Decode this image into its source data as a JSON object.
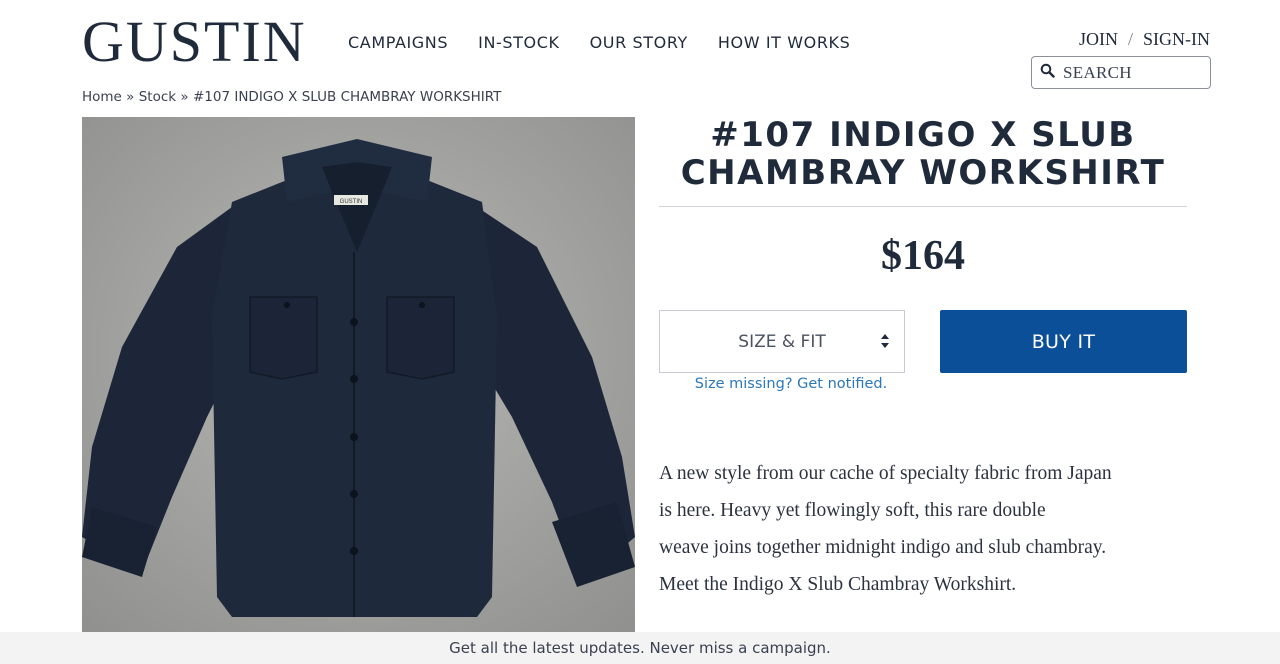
{
  "header": {
    "logo": "GUSTIN",
    "nav": [
      {
        "label": "CAMPAIGNS"
      },
      {
        "label": "IN-STOCK"
      },
      {
        "label": "OUR STORY"
      },
      {
        "label": "HOW IT WORKS"
      }
    ],
    "account": {
      "join": "JOIN",
      "separator": "/",
      "signin": "SIGN-IN"
    },
    "search": {
      "placeholder": "SEARCH",
      "icon": "search-icon"
    }
  },
  "breadcrumb": {
    "home": "Home",
    "sep": "»",
    "stock": "Stock",
    "current": "#107 INDIGO X SLUB CHAMBRAY WORKSHIRT"
  },
  "product": {
    "title_line1": "#107 INDIGO X SLUB",
    "title_line2": "CHAMBRAY WORKSHIRT",
    "price": "$164",
    "size_select_label": "SIZE & FIT",
    "buy_label": "BUY IT",
    "notify_link": "Size missing? Get notified.",
    "description_lines": [
      "A new style from our cache of specialty fabric from Japan",
      "is here. Heavy yet flowingly soft, this rare double",
      "weave joins together midnight indigo and slub chambray.",
      "Meet the Indigo X Slub Chambray Workshirt."
    ],
    "shirt_label_text": "GUSTIN",
    "colors": {
      "button": "#0b4f98",
      "link": "#2b77b8",
      "shirt": "#1c2638"
    }
  },
  "footer_bar": {
    "text": "Get all the latest updates. Never miss a campaign."
  }
}
